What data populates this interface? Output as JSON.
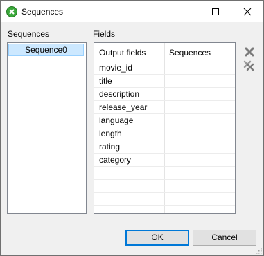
{
  "window": {
    "title": "Sequences"
  },
  "labels": {
    "sequences": "Sequences",
    "fields": "Fields"
  },
  "sequences_list": {
    "items": [
      "Sequence0"
    ],
    "selected_index": 0
  },
  "fields_table": {
    "columns": [
      "Output fields",
      "Sequences"
    ],
    "rows": [
      "movie_id",
      "title",
      "description",
      "release_year",
      "language",
      "length",
      "rating",
      "category"
    ]
  },
  "icons": {
    "app": "sequence-app-icon",
    "delete": "delete-x-icon",
    "delete_all": "delete-all-icon"
  },
  "buttons": {
    "ok": "OK",
    "cancel": "Cancel"
  },
  "colors": {
    "selection": "#cce8ff",
    "accent": "#0078d7",
    "delete_icon": "#7a7a7a",
    "app_icon": "#3aa83a"
  }
}
